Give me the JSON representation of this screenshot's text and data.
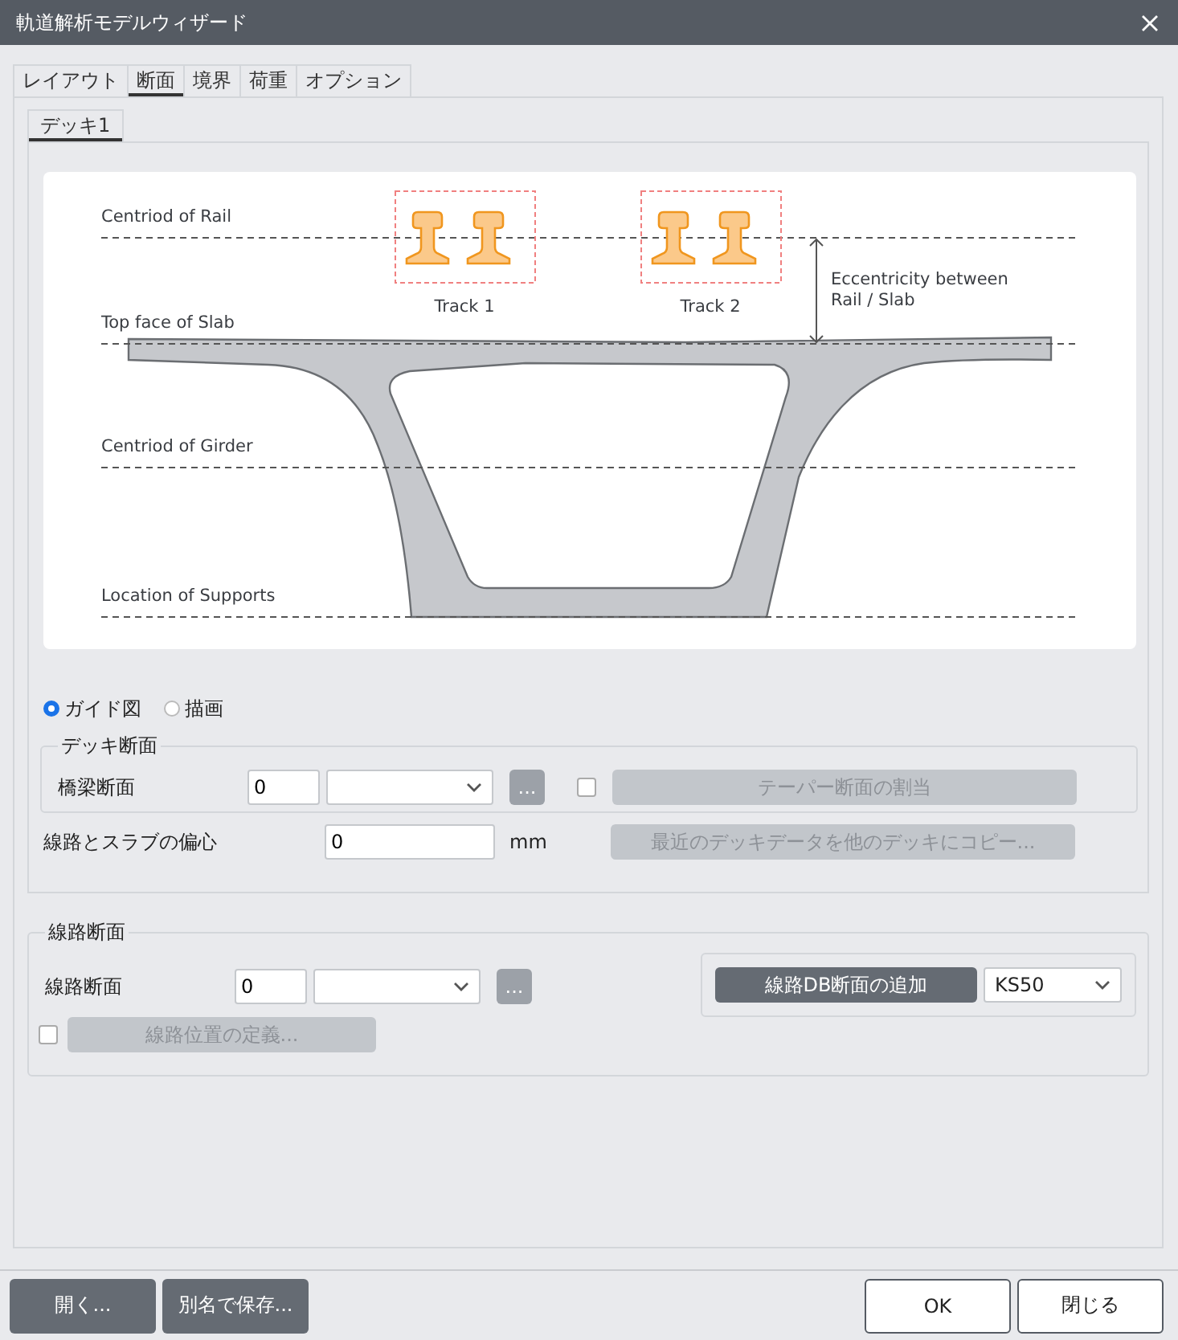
{
  "window": {
    "title": "軌道解析モデルウィザード"
  },
  "tabs": [
    {
      "label": "レイアウト",
      "selected": false
    },
    {
      "label": "断面",
      "selected": true
    },
    {
      "label": "境界",
      "selected": false
    },
    {
      "label": "荷重",
      "selected": false
    },
    {
      "label": "オプション",
      "selected": false
    }
  ],
  "deck_tabs": [
    {
      "label": "デッキ1",
      "selected": true
    }
  ],
  "diagram": {
    "reference_lines": [
      {
        "label": "Centriod of Rail"
      },
      {
        "label": "Top face of Slab"
      },
      {
        "label": "Centriod of Girder"
      },
      {
        "label": "Location of Supports"
      }
    ],
    "tracks": [
      {
        "label": "Track 1"
      },
      {
        "label": "Track 2"
      }
    ],
    "eccentricity_label": [
      "Eccentricity between",
      "Rail / Slab"
    ]
  },
  "view_options": [
    {
      "label": "ガイド図",
      "selected": true
    },
    {
      "label": "描画",
      "selected": false
    }
  ],
  "deck_section": {
    "title": "デッキ断面",
    "label": "橋梁断面",
    "number": "0",
    "browse": "...",
    "taper_checked": false,
    "taper_button": {
      "label": "テーパー断面の割当",
      "disabled": true
    }
  },
  "eccentricity": {
    "label": "線路とスラブの偏心",
    "value": "0",
    "unit": "mm",
    "copy_button": {
      "label": "最近のデッキデータを他のデッキにコピー...",
      "disabled": true
    }
  },
  "track_section": {
    "title": "線路断面",
    "label": "線路断面",
    "number": "0",
    "browse": "...",
    "define_checked": false,
    "define_button": {
      "label": "線路位置の定義...",
      "disabled": true
    },
    "db_button": "線路DB断面の追加",
    "db_select": "KS50"
  },
  "footer": {
    "left": [
      "開く...",
      "別名で保存..."
    ],
    "right": [
      "OK",
      "閉じる"
    ]
  }
}
